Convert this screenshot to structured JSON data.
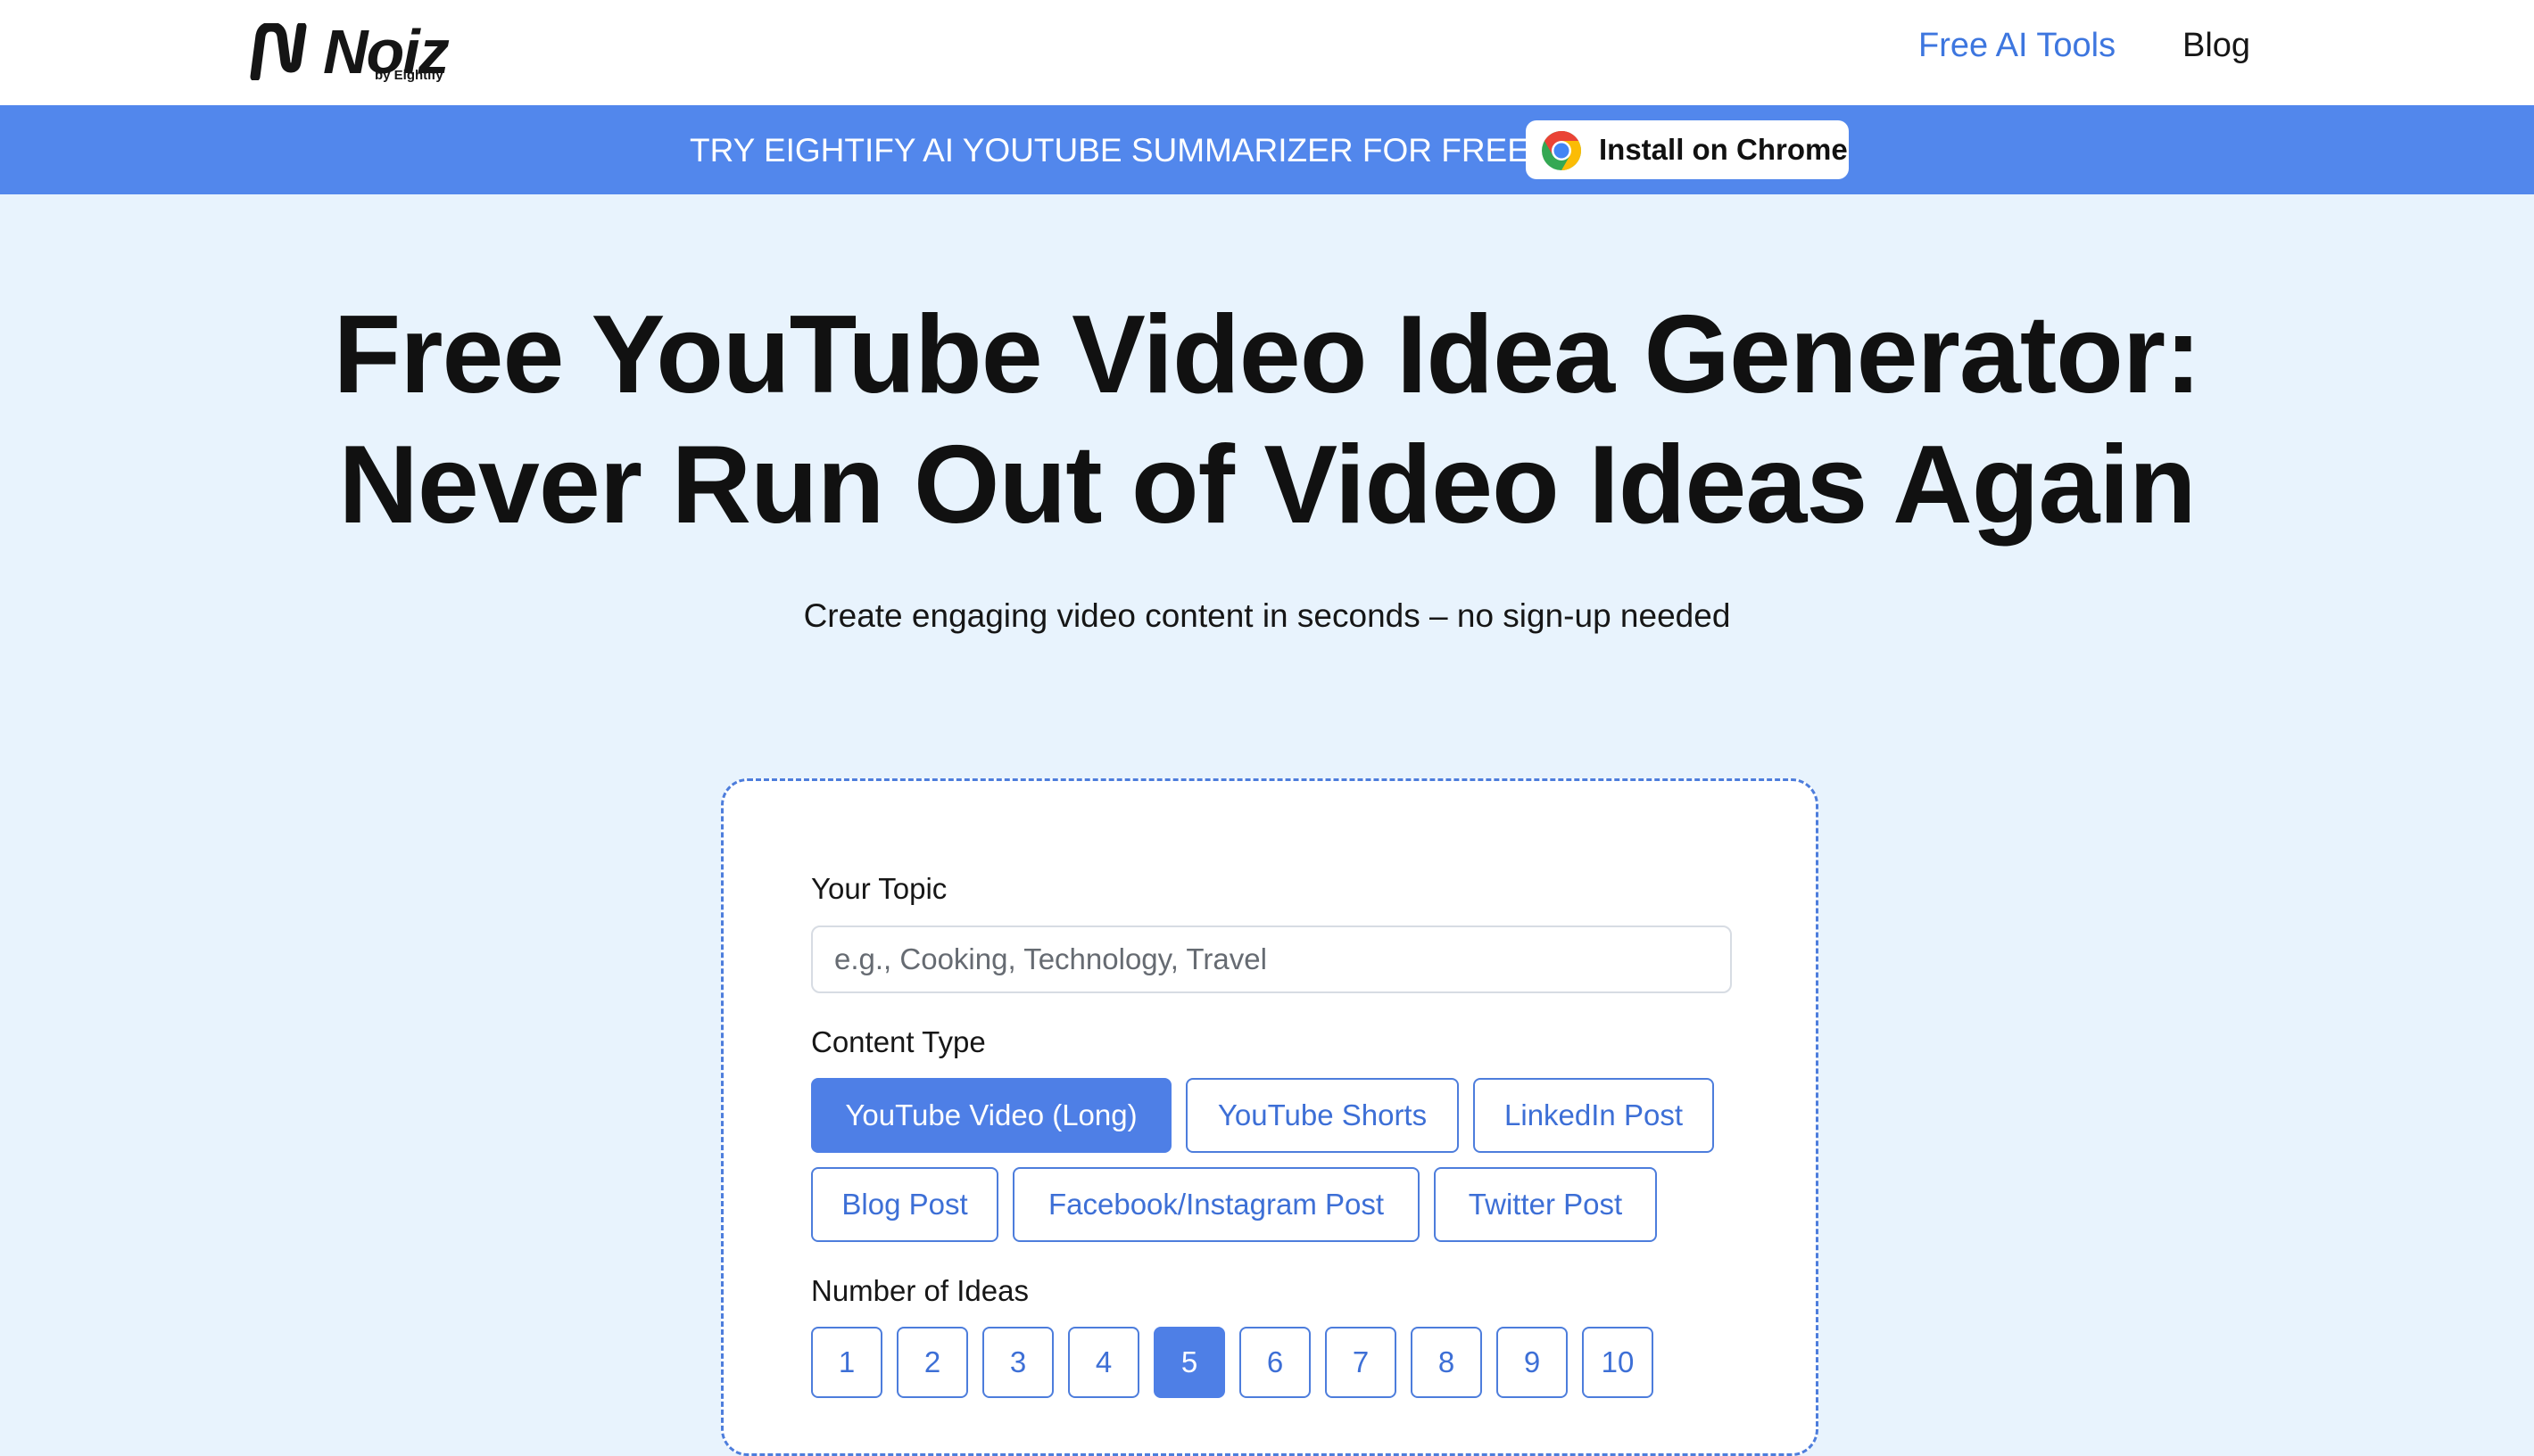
{
  "header": {
    "logo_text": "Noiz",
    "logo_byline": "by Eightify",
    "nav": [
      {
        "label": "Free AI Tools",
        "color": "#3d76df"
      },
      {
        "label": "Blog",
        "color": "#161616"
      }
    ]
  },
  "promo": {
    "text": "TRY EIGHTIFY AI YOUTUBE SUMMARIZER FOR FREE",
    "button_label": "Install on Chrome",
    "button_icon": "chrome-icon",
    "background": "#5287ec"
  },
  "hero": {
    "title_line1": "Free YouTube Video Idea Generator:",
    "title_line2": "Never Run Out of Video Ideas Again",
    "subtitle": "Create engaging video content in seconds – no sign-up needed"
  },
  "form": {
    "topic_label": "Your Topic",
    "topic_value": "",
    "topic_placeholder": "e.g., Cooking, Technology, Travel",
    "content_type_label": "Content Type",
    "content_types": [
      {
        "label": "YouTube Video (Long)",
        "selected": true
      },
      {
        "label": "YouTube Shorts",
        "selected": false
      },
      {
        "label": "LinkedIn Post",
        "selected": false
      },
      {
        "label": "Blog Post",
        "selected": false
      },
      {
        "label": "Facebook/Instagram Post",
        "selected": false
      },
      {
        "label": "Twitter Post",
        "selected": false
      }
    ],
    "ideas_label": "Number of Ideas",
    "idea_counts": [
      "1",
      "2",
      "3",
      "4",
      "5",
      "6",
      "7",
      "8",
      "9",
      "10"
    ],
    "selected_count": "5"
  },
  "colors": {
    "accent": "#4e7fe6",
    "page_background": "#e8f3fd"
  }
}
